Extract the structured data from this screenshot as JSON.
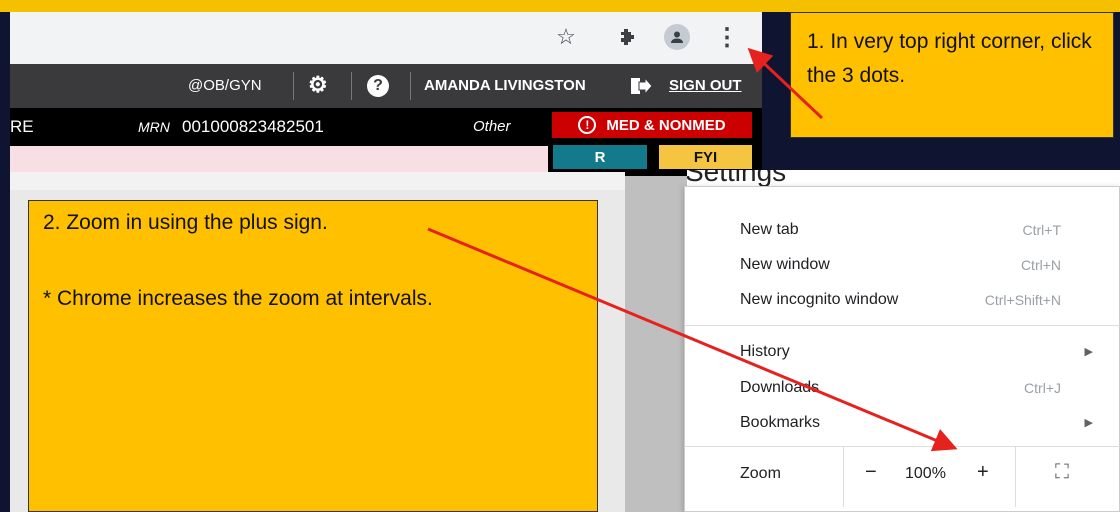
{
  "browser": {
    "toolbar_icons": [
      "star-icon",
      "puzzle-icon",
      "profile-icon",
      "kebab-menu-icon"
    ],
    "star_glyph": "☆",
    "puzzle_glyph": "✱",
    "dots_glyph": "⋮"
  },
  "ehr_header": {
    "department": "@OB/GYN",
    "settings_glyph": "⚙",
    "help_glyph": "?",
    "user_name": "AMANDA LIVINGSTON",
    "sign_out": "SIGN OUT"
  },
  "patient_band": {
    "name_fragment": "RE",
    "mrn_label": "MRN",
    "mrn_value": "001000823482501",
    "gender": "Other",
    "alert_badge": "MED & NONMED",
    "alert_glyph": "!",
    "r_badge": "R",
    "fyi_badge": "FYI"
  },
  "callouts": {
    "step1": "1. In very top right corner, click the 3 dots.",
    "step2": "2. Zoom in using the plus sign.",
    "note": "* Chrome increases the zoom at intervals."
  },
  "settings_peek": "Settings",
  "chrome_menu": {
    "groups": [
      [
        {
          "label": "New tab",
          "shortcut": "Ctrl+T"
        },
        {
          "label": "New window",
          "shortcut": "Ctrl+N"
        },
        {
          "label": "New incognito window",
          "shortcut": "Ctrl+Shift+N"
        }
      ],
      [
        {
          "label": "History",
          "submenu": true
        },
        {
          "label": "Downloads",
          "shortcut": "Ctrl+J"
        },
        {
          "label": "Bookmarks",
          "submenu": true
        }
      ]
    ],
    "zoom": {
      "label": "Zoom",
      "minus": "−",
      "value": "100%",
      "plus": "+",
      "fullscreen_glyph": "⛶"
    }
  },
  "colors": {
    "callout_fill": "#ffc000",
    "arrow": "#e5221e",
    "alert_red": "#cc0000",
    "r_teal": "#127a8a",
    "fyi_yellow": "#f5c542"
  }
}
